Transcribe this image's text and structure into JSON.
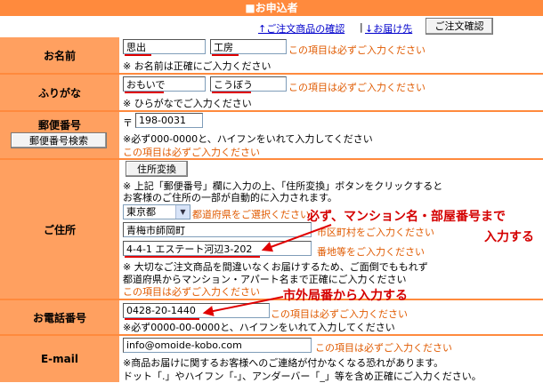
{
  "header": {
    "title": "■お申込者"
  },
  "topnav": {
    "link_cart": "↑ご注文商品の確認",
    "separator": "|",
    "link_delivery": "↓お届け先",
    "confirm_button": "ご注文確認"
  },
  "form": {
    "name": {
      "label": "お名前",
      "last": "思出",
      "first": "工房",
      "required": "この項目は必ずご入力ください",
      "note": "※ お名前は正確にご入力ください"
    },
    "kana": {
      "label": "ふりがな",
      "last": "おもいで",
      "first": "こうぼう",
      "required": "この項目は必ずご入力ください",
      "note": "※ ひらがなでご入力ください"
    },
    "postal": {
      "label": "郵便番号",
      "search_button": "郵便番号検索",
      "mark": "〒",
      "value": "198-0031",
      "note": "※必ず000-0000と、ハイフンをいれて入力してください",
      "required": "この項目は必ずご入力ください"
    },
    "address": {
      "label": "ご住所",
      "convert_button": "住所変換",
      "note1": "※ 上記「郵便番号」欄に入力の上、「住所変換」ボタンをクリックすると",
      "note2": "お客様のご住所の一部が自動的に入力されます。",
      "prefecture": "東京都",
      "prefecture_hint": "都道府県をご選択ください",
      "city": "青梅市師岡町",
      "city_hint": "市区町村をご入力ください",
      "street": "4-4-1 エステート河辺3-202",
      "street_hint": "番地等をご入力ください",
      "note3": "※ 大切なご注文商品を間違いなくお届けするため、ご面倒でももれず",
      "note4": "都道府県からマンション・アパート名まで正確にご入力ください",
      "required": "この項目は必ずご入力ください",
      "annotation_line1": "必ず、マンション名・部屋番号まで",
      "annotation_line2": "入力する"
    },
    "phone": {
      "label": "お電話番号",
      "value": "0428-20-1440",
      "required": "この項目は必ずご入力ください",
      "note": "※必ず0000-00-0000と、ハイフンをいれて入力してください",
      "annotation": "市外局番から入力する"
    },
    "email": {
      "label": "E-mail",
      "value": "info@omoide-kobo.com",
      "required": "この項目は必ずご入力ください",
      "note1": "※商品お届けに関するお客様へのご連絡が付かなくなる恐れがあります。",
      "note2": "ドット「.」やハイフン「-」、アンダーバー「_」等を含め正確にご入力ください。"
    }
  },
  "colors": {
    "accent": "#ff8a3d",
    "label_bg": "#ffa060",
    "required_text": "#e05a00",
    "annotation": "#d40000"
  }
}
